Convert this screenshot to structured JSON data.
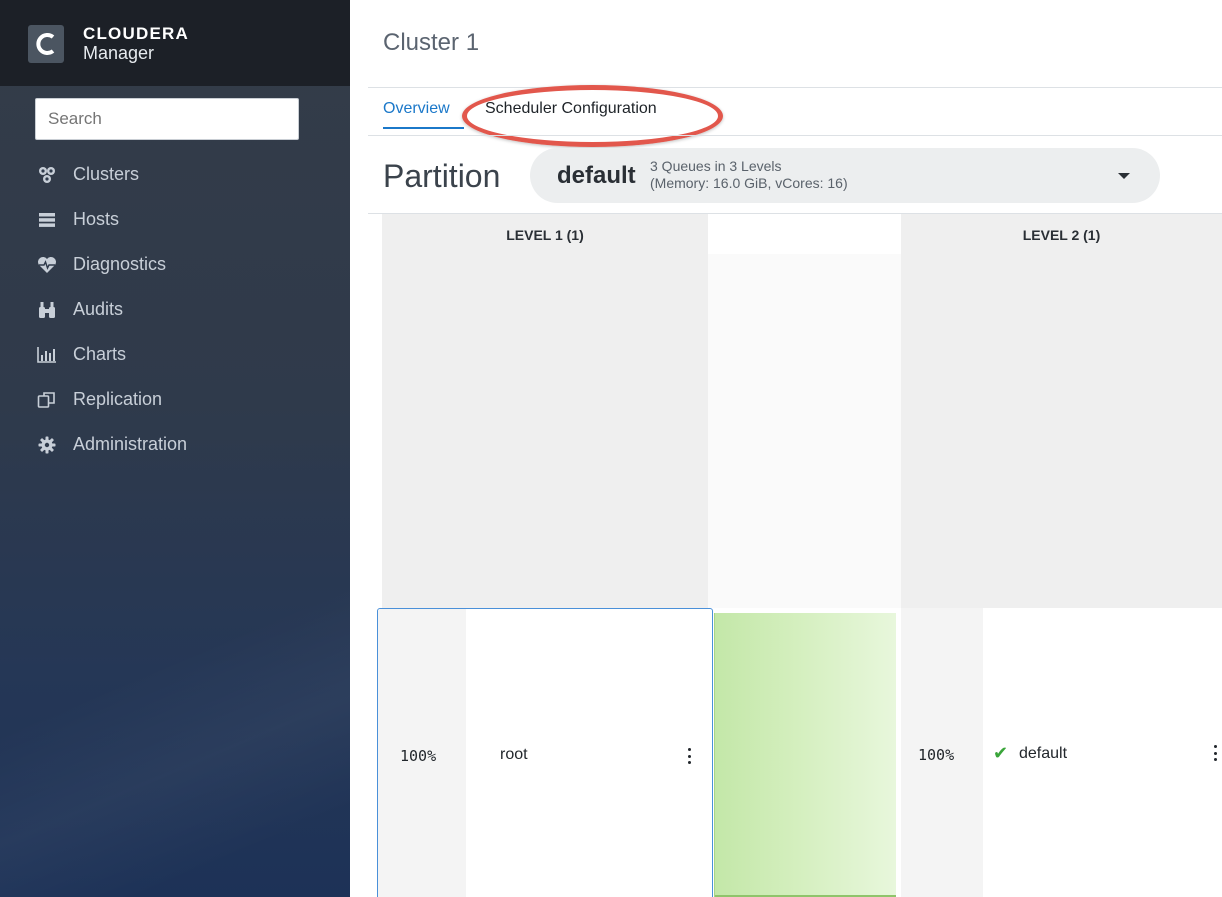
{
  "brand": {
    "line1": "CLOUDERA",
    "line2": "Manager"
  },
  "search": {
    "placeholder": "Search"
  },
  "nav": {
    "items": [
      {
        "label": "Clusters",
        "icon": "clusters-icon"
      },
      {
        "label": "Hosts",
        "icon": "hosts-icon"
      },
      {
        "label": "Diagnostics",
        "icon": "heartbeat-icon"
      },
      {
        "label": "Audits",
        "icon": "binoculars-icon"
      },
      {
        "label": "Charts",
        "icon": "bar-chart-icon"
      },
      {
        "label": "Replication",
        "icon": "replication-icon"
      },
      {
        "label": "Administration",
        "icon": "gear-icon"
      }
    ]
  },
  "main": {
    "title": "Cluster 1",
    "tabs": [
      {
        "label": "Overview",
        "active": true
      },
      {
        "label": "Scheduler Configuration",
        "active": false,
        "highlighted": true
      }
    ],
    "partition": {
      "label": "Partition",
      "selected": "default",
      "summary": "3 Queues in 3 Levels",
      "resources": "(Memory: 16.0 GiB, vCores: 16)"
    },
    "levels": [
      {
        "header": "LEVEL 1 (1)"
      },
      {
        "header": "LEVEL 2 (1)"
      }
    ],
    "queues": {
      "root": {
        "percent": "100%",
        "name": "root"
      },
      "default": {
        "percent": "100%",
        "name": "default",
        "status": "check-icon"
      }
    }
  },
  "colors": {
    "accent": "#1b78c9",
    "highlight": "#e2574c",
    "sidebar_top": "#1c2027",
    "connector": "#c3e7a8",
    "status_ok": "#3aa53a"
  }
}
